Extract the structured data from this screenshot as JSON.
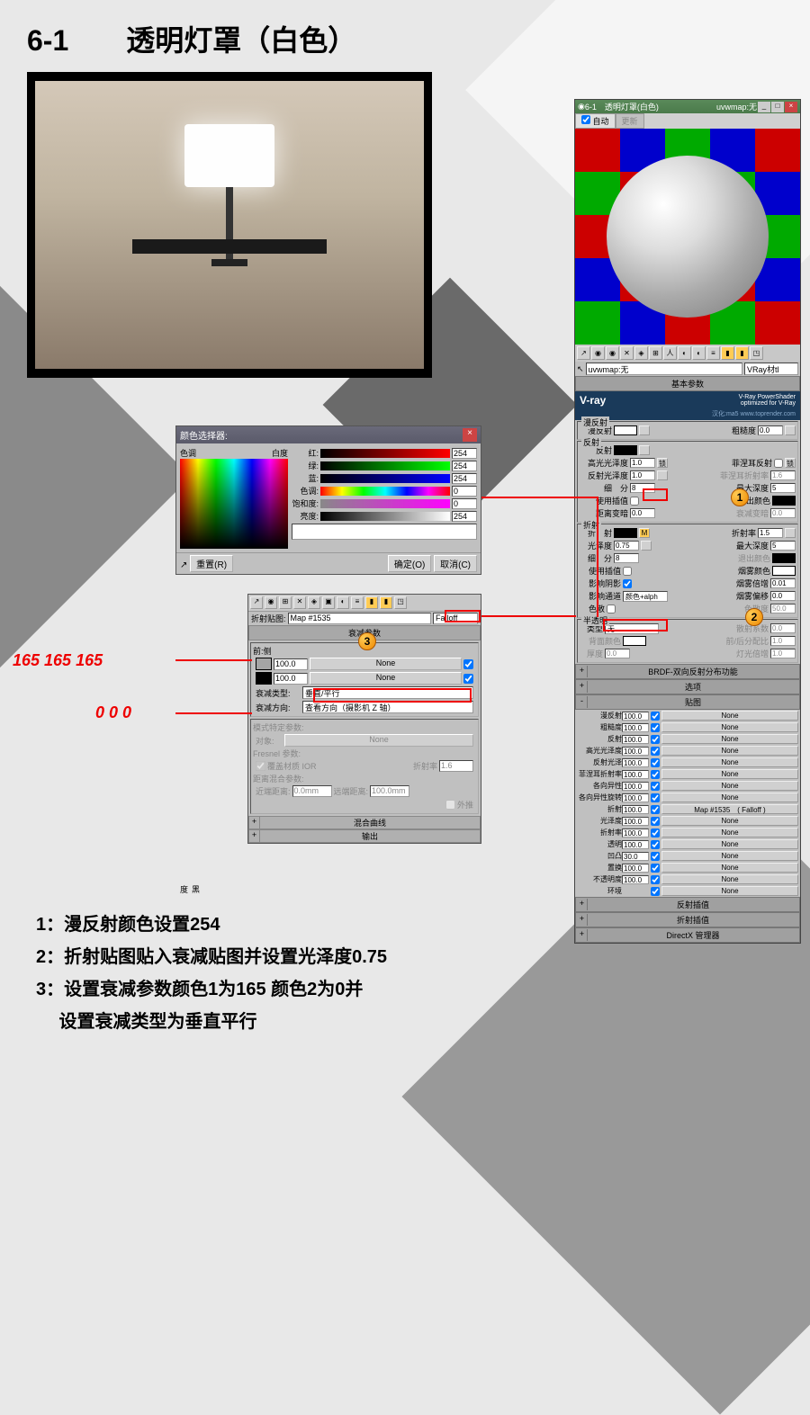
{
  "title": "6-1　　透明灯罩（白色）",
  "color_picker": {
    "title": "颜色选择器:",
    "axis_hue": "色调",
    "axis_white": "白度",
    "axis_black": "黑度",
    "red_label": "红:",
    "green_label": "绿:",
    "blue_label": "蓝:",
    "hue_label": "色调:",
    "sat_label": "饱和度:",
    "val_label": "亮度:",
    "red": "254",
    "green": "254",
    "blue": "254",
    "hue": "0",
    "sat": "0",
    "val": "254",
    "reset": "重置(R)",
    "ok": "确定(O)",
    "cancel": "取消(C)"
  },
  "falloff": {
    "map_label": "折射贴图:",
    "map_slot": "Map #1535",
    "map_type": "Falloff",
    "header": "衰减参数",
    "front_side": "前:侧",
    "color1_val": "100.0",
    "color1_map": "None",
    "color2_val": "100.0",
    "color2_map": "None",
    "type_label": "衰减类型:",
    "type_val": "垂直/平行",
    "dir_label": "衰减方向:",
    "dir_val": "查看方向（摄影机 Z 轴）",
    "mode_header": "模式特定参数:",
    "object_label": "对象:",
    "object_val": "None",
    "fresnel_label": "Fresnel 参数:",
    "override_ior": "覆盖材质 IOR",
    "ior_label": "折射率",
    "ior_val": "1.6",
    "dist_header": "距离混合参数:",
    "near_label": "近端距离:",
    "near_val": "0.0mm",
    "far_label": "远端距离:",
    "far_val": "100.0mm",
    "extrap": "外推",
    "mix_curve": "混合曲线",
    "output": "输出"
  },
  "annot": {
    "rgb165": "165  165  165",
    "rgb0": "0  0  0"
  },
  "vray": {
    "win_title": "6-1　透明灯罩(白色)",
    "win_uvw": "uvwmap:无",
    "tab_auto": "自动",
    "tab_update": "更新",
    "nav_map": "uvwmap:无",
    "nav_mtl": "VRay材tl",
    "hdr_basic": "基本参数",
    "logo": "V-ray",
    "logo_sub1": "V-Ray PowerShader",
    "logo_sub2": "optimized for V-Ray",
    "logo_sub3": "汉化:ma5 www.toprender.com",
    "grp_diffuse": "漫反射",
    "lbl_diffuse": "漫反射",
    "lbl_rough": "粗糙度",
    "val_rough": "0.0",
    "grp_reflect": "反射",
    "lbl_reflect": "反射",
    "lbl_hilight": "高光光泽度",
    "val_hilight": "1.0",
    "lbl_lock": "锁",
    "lbl_fresnel": "菲涅耳反射",
    "lbl_refl_gloss": "反射光泽度",
    "val_refl_gloss": "1.0",
    "lbl_fresnel_ior": "菲涅耳折射率",
    "val_fresnel_ior": "1.6",
    "lbl_subdiv": "细　分",
    "val_subdiv": "8",
    "lbl_maxdepth": "最大深度",
    "val_maxdepth": "5",
    "lbl_interp": "使用插值",
    "lbl_exit": "退出颜色",
    "lbl_dim": "距离变暗",
    "val_dim": "0.0",
    "lbl_dim_on": "衰减变暗",
    "val_dim_on": "0.0",
    "grp_refract": "折射",
    "lbl_refract": "折　射",
    "lbl_ior": "折射率",
    "val_ior": "1.5",
    "lbl_gloss": "光泽度",
    "val_gloss": "0.75",
    "lbl_maxdepth2": "最大深度",
    "val_maxdepth2": "5",
    "lbl_subdiv2": "细　分",
    "val_subdiv2": "8",
    "lbl_exit2": "退出颜色",
    "lbl_interp2": "使用插值",
    "lbl_fog": "烟雾颜色",
    "lbl_shadow": "影响阴影",
    "lbl_fog_mult": "烟雾倍增",
    "val_fog_mult": "0.01",
    "lbl_affect": "影响通道",
    "val_affect": "颜色+alph",
    "lbl_fog_bias": "烟雾偏移",
    "val_fog_bias": "0.0",
    "lbl_dispersion": "色散",
    "lbl_abbe": "色散度",
    "val_abbe": "50.0",
    "grp_trans": "半透明",
    "lbl_type": "类型",
    "val_type": "无",
    "lbl_scatter": "散射系数",
    "val_scatter": "0.0",
    "lbl_back": "背面颜色",
    "lbl_fb": "前/后分配比",
    "val_fb": "1.0",
    "lbl_thick": "厚度",
    "val_thick": "0.0",
    "lbl_light": "灯光倍增",
    "val_light": "1.0",
    "hdr_brdf": "BRDF-双向反射分布功能",
    "hdr_options": "选项",
    "hdr_maps": "贴图",
    "maps": [
      {
        "label": "漫反射",
        "val": "100.0",
        "map": "None"
      },
      {
        "label": "粗糙度",
        "val": "100.0",
        "map": "None"
      },
      {
        "label": "反射",
        "val": "100.0",
        "map": "None"
      },
      {
        "label": "高光光泽度",
        "val": "100.0",
        "map": "None"
      },
      {
        "label": "反射光泽",
        "val": "100.0",
        "map": "None"
      },
      {
        "label": "菲涅耳折射率",
        "val": "100.0",
        "map": "None"
      },
      {
        "label": "各向异性",
        "val": "100.0",
        "map": "None"
      },
      {
        "label": "各向异性旋转",
        "val": "100.0",
        "map": "None"
      },
      {
        "label": "折射",
        "val": "100.0",
        "map": "Map #1535　( Falloff )"
      },
      {
        "label": "光泽度",
        "val": "100.0",
        "map": "None"
      },
      {
        "label": "折射率",
        "val": "100.0",
        "map": "None"
      },
      {
        "label": "透明",
        "val": "100.0",
        "map": "None"
      },
      {
        "label": "凹凸",
        "val": "30.0",
        "map": "None"
      },
      {
        "label": "置换",
        "val": "100.0",
        "map": "None"
      },
      {
        "label": "不透明度",
        "val": "100.0",
        "map": "None"
      },
      {
        "label": "环境",
        "val": "",
        "map": "None"
      }
    ],
    "hdr_refl_interp": "反射插值",
    "hdr_refr_interp": "折射插值",
    "hdr_dx": "DirectX 管理器"
  },
  "instructions": {
    "line1": "1：漫反射颜色设置254",
    "line2": "2：折射贴图贴入衰减贴图并设置光泽度0.75",
    "line3a": "3：设置衰减参数颜色1为165 颜色2为0并",
    "line3b": "　 设置衰减类型为垂直平行"
  }
}
